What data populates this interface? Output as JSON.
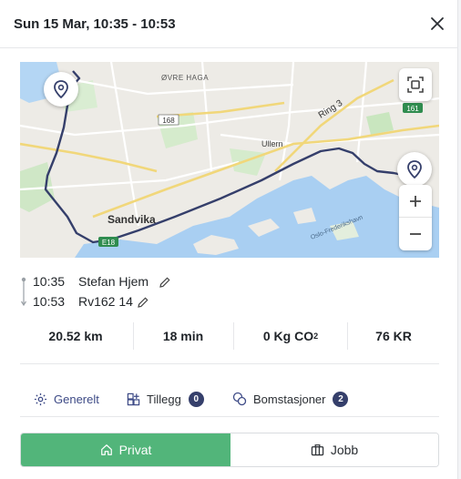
{
  "header": {
    "title": "Sun 15 Mar, 10:35 - 10:53"
  },
  "map": {
    "labels": {
      "ovre_haga": "ØVRE HAGA",
      "road_168": "168",
      "ring3": "Ring 3",
      "road_161": "161",
      "ullern": "Ullern",
      "sandvika": "Sandvika",
      "oslo_frederikshavn": "Oslo-Frederikshavn",
      "e18": "E18"
    },
    "route_color": "#353f6b",
    "water_color": "#a9cff2",
    "park_color": "#c9e8c1"
  },
  "trip": {
    "start_time": "10:35",
    "start_label": "Stefan Hjem",
    "end_time": "10:53",
    "end_label": "Rv162 14"
  },
  "stats": {
    "distance": "20.52 km",
    "duration": "18 min",
    "co2_value": "0 Kg CO",
    "co2_sub": "2",
    "cost": "76 KR"
  },
  "tabs": [
    {
      "label": "Generelt",
      "color": "#3d4a86"
    },
    {
      "label": "Tillegg",
      "count": "0"
    },
    {
      "label": "Bomstasjoner",
      "count": "2"
    }
  ],
  "type_toggle": {
    "private_label": "Privat",
    "work_label": "Jobb",
    "active_color": "#52b57a"
  }
}
